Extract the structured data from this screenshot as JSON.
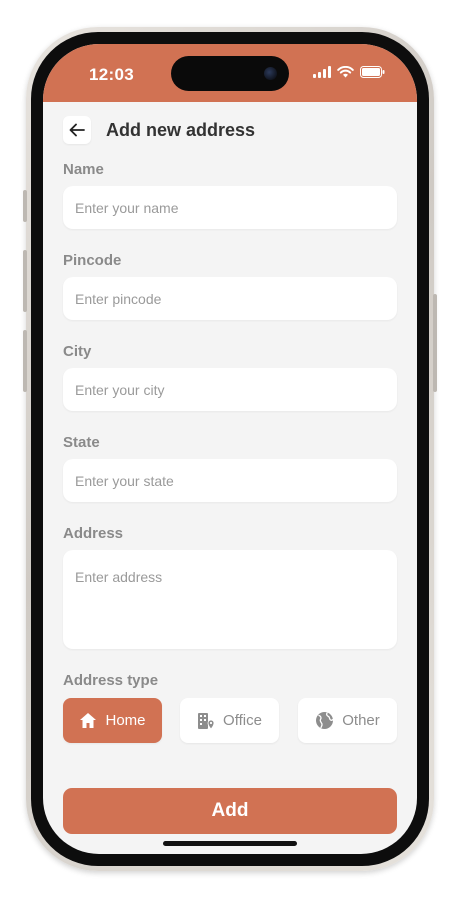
{
  "status_bar": {
    "time": "12:03",
    "icons": [
      "signal-icon",
      "wifi-icon",
      "battery-icon"
    ]
  },
  "header": {
    "title": "Add new address",
    "back_icon": "arrow-left-icon"
  },
  "form": {
    "name": {
      "label": "Name",
      "placeholder": "Enter your name",
      "value": ""
    },
    "pincode": {
      "label": "Pincode",
      "placeholder": "Enter pincode",
      "value": ""
    },
    "city": {
      "label": "City",
      "placeholder": "Enter your city",
      "value": ""
    },
    "state": {
      "label": "State",
      "placeholder": "Enter your state",
      "value": ""
    },
    "address": {
      "label": "Address",
      "placeholder": "Enter address",
      "value": ""
    }
  },
  "address_type": {
    "label": "Address type",
    "selected": "Home",
    "options": [
      {
        "label": "Home",
        "icon": "home-icon"
      },
      {
        "label": "Office",
        "icon": "office-building-icon"
      },
      {
        "label": "Other",
        "icon": "globe-icon"
      }
    ]
  },
  "actions": {
    "add_label": "Add"
  },
  "colors": {
    "accent": "#d17253",
    "background": "#f4f4f4",
    "field_bg": "#ffffff",
    "label_text": "#8a8a8a"
  }
}
